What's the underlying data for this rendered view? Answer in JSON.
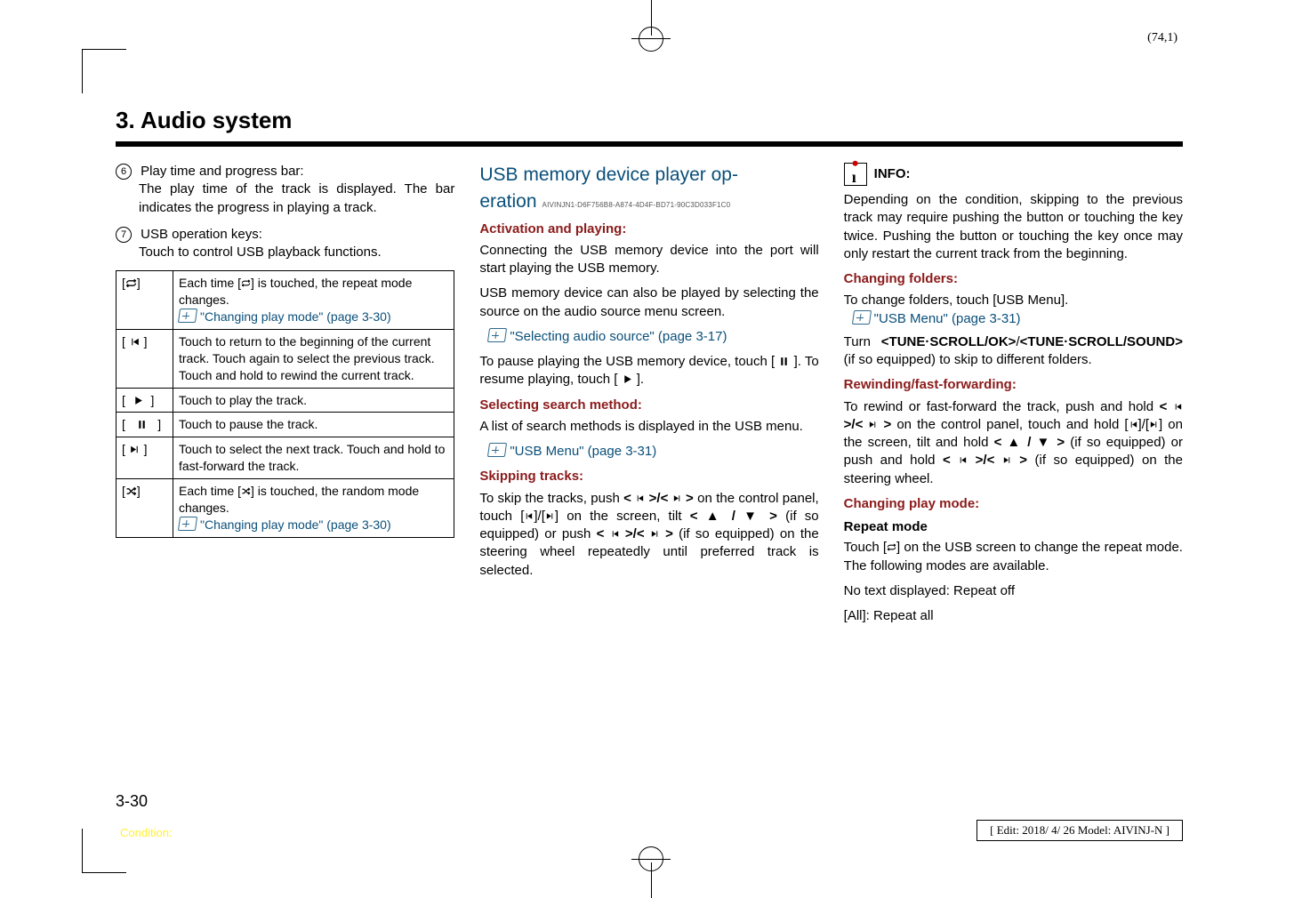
{
  "corner": "(74,1)",
  "section_title": "3. Audio system",
  "col1": {
    "item6_label": "Play time and progress bar:",
    "item6_body": "The play time of the track is displayed. The bar indicates the progress in playing a track.",
    "item7_label": "USB operation keys:",
    "item7_body": "Touch to control USB playback functions.",
    "table": [
      {
        "icon": "repeat",
        "text_a": "Each time [",
        "text_b": "] is touched, the repeat mode changes.",
        "link": "\"Changing play mode\" (page 3-30)"
      },
      {
        "icon": "prev",
        "text": "Touch to return to the beginning of the current track. Touch again to select the previous track. Touch and hold to rewind the current track."
      },
      {
        "icon": "play",
        "text": "Touch to play the track."
      },
      {
        "icon": "pause",
        "text": "Touch to pause the track."
      },
      {
        "icon": "next",
        "text": "Touch to select the next track. Touch and hold to fast-forward the track."
      },
      {
        "icon": "shuffle",
        "text_a": "Each time [",
        "text_b": "] is touched, the random mode changes.",
        "link": "\"Changing play mode\" (page 3-30)"
      }
    ]
  },
  "col2": {
    "heading_a": "USB memory device player op-",
    "heading_b": "eration",
    "guid": "AIVINJN1-D6F756B8-A874-4D4F-BD71-90C3D033F1C0",
    "h_activation": "Activation and playing:",
    "p1": "Connecting the USB memory device into the port will start playing the USB memory.",
    "p2": "USB memory device can also be played by selecting the source on the audio source menu screen.",
    "link1": "\"Selecting audio source\" (page 3-17)",
    "p3a": "To pause playing the USB memory device, touch [",
    "p3b": "]. To resume playing, touch [",
    "p3c": "].",
    "h_select": "Selecting search method:",
    "p4": "A list of search methods is displayed in the USB menu.",
    "link2": "\"USB Menu\" (page 3-31)",
    "h_skip": "Skipping tracks:",
    "p5a": "To skip the tracks, push ",
    "p5b": " on the control panel, touch [",
    "p5c": "]/[",
    "p5d": "] on the screen, tilt ",
    "p5e": " (if so equipped) or push ",
    "p5f": " (if so equipped) on the steering wheel repeatedly until preferred track is selected."
  },
  "col3": {
    "info_label": "INFO:",
    "info_body": "Depending on the condition, skipping to the previous track may require pushing the button or touching the key twice. Pushing the button or touching the key once may only restart the current track from the beginning.",
    "h_folders": "Changing folders:",
    "p_folders": "To change folders, touch [USB Menu].",
    "link3": "\"USB Menu\" (page 3-31)",
    "p_turn_a": "Turn ",
    "p_turn_b": "<TUNE·SCROLL/OK>",
    "p_turn_c": "/",
    "p_turn_d": "<TUNE·SCROLL/SOUND>",
    "p_turn_e": " (if so equipped) to skip to different folders.",
    "h_rewind": "Rewinding/fast-forwarding:",
    "p_rw_a": "To rewind or fast-forward the track, push and hold ",
    "p_rw_b": " on the control panel, touch and hold [",
    "p_rw_c": "]/[",
    "p_rw_d": "] on the screen, tilt and hold ",
    "p_rw_e": " (if so equipped) or push and hold ",
    "p_rw_f": " (if so equipped) on the steering wheel.",
    "h_mode": "Changing play mode:",
    "h_repeat": "Repeat mode",
    "p_rep_a": "Touch [",
    "p_rep_b": "] on the USB screen to change the repeat mode. The following modes are available.",
    "p_no": "No text displayed: Repeat off",
    "p_all": "[All]: Repeat all"
  },
  "page_num": "3-30",
  "condition": "Condition:",
  "edit": "[ Edit: 2018/ 4/ 26    Model: AIVINJ-N ]"
}
